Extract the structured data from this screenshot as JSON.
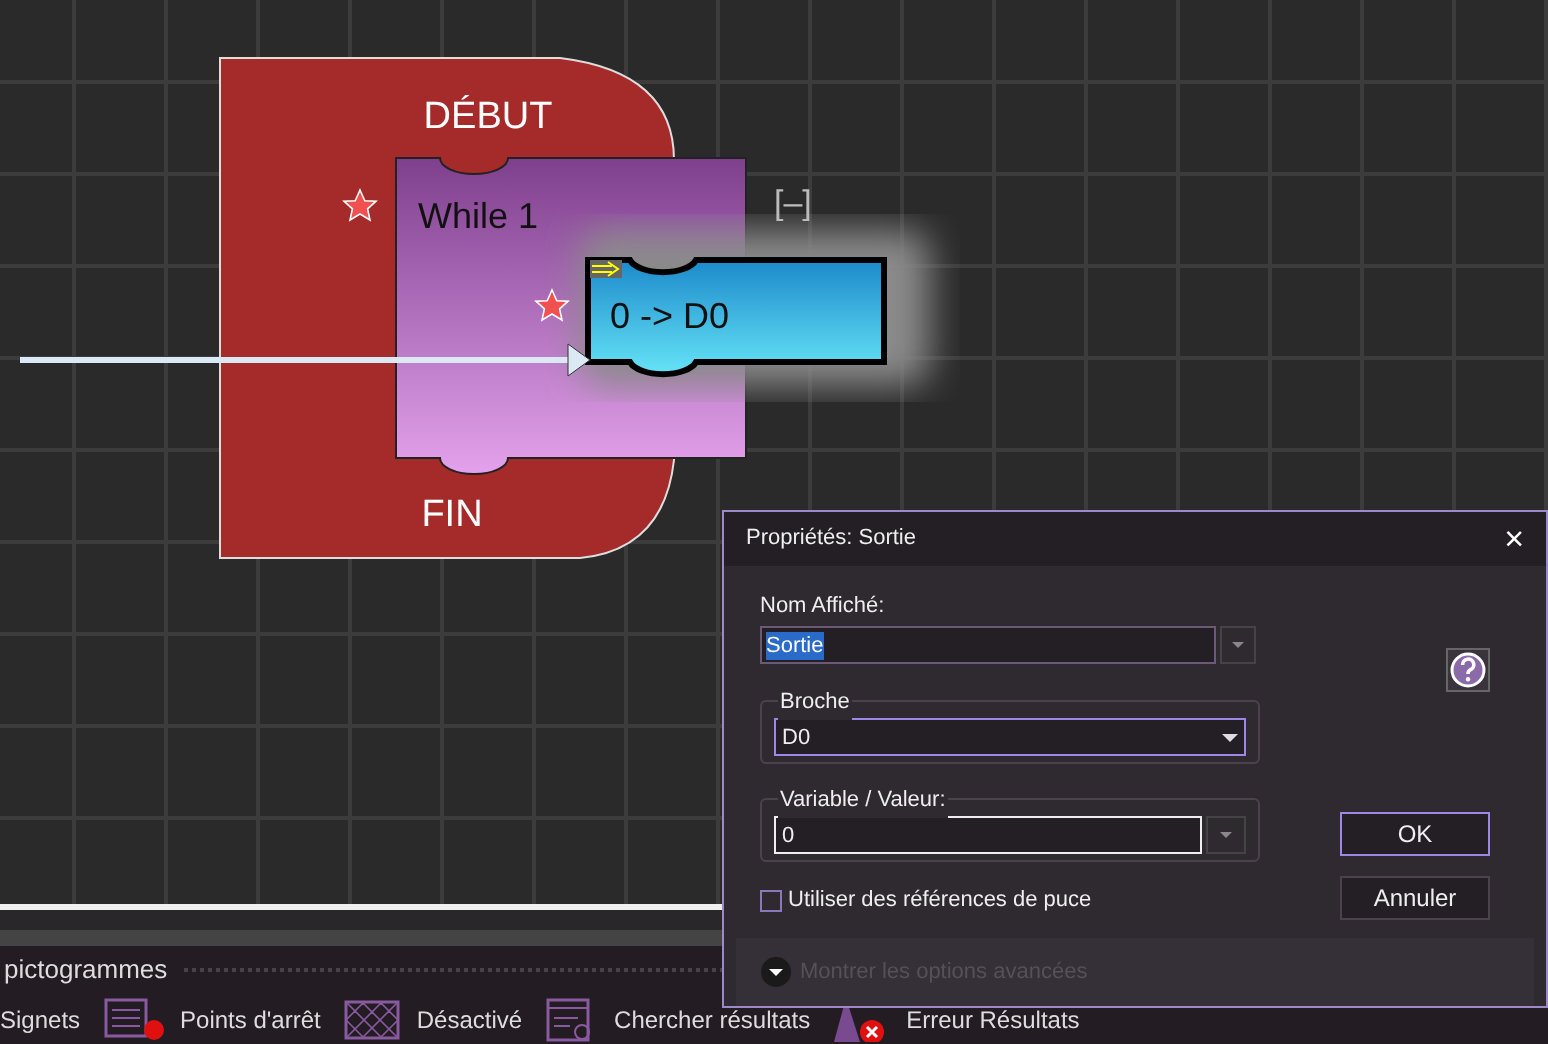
{
  "diagram": {
    "start_label": "DÉBUT",
    "end_label": "FIN",
    "loop_label": "While 1",
    "block_label": "0 -> D0",
    "collapse_toggle": "[–]"
  },
  "panel": {
    "title": "pictogrammes",
    "legend": [
      {
        "label": "Signets",
        "kind": "plain"
      },
      {
        "label": "Points d'arrêt",
        "kind": "breakpoint"
      },
      {
        "label": "Désactivé",
        "kind": "disabled"
      },
      {
        "label": "Chercher résultats",
        "kind": "search"
      },
      {
        "label": "Erreur Résultats",
        "kind": "error"
      }
    ]
  },
  "dialog": {
    "title": "Propriétés: Sortie",
    "close": "×",
    "name_label": "Nom Affiché:",
    "name_value": "Sortie",
    "pin_label": "Broche",
    "pin_value": "D0",
    "value_label": "Variable / Valeur:",
    "value_value": "0",
    "chip_refs": {
      "label": "Utiliser des références de puce",
      "checked": false
    },
    "advanced": {
      "label": "Montrer les options avancées",
      "disabled": true
    },
    "buttons": [
      {
        "label": "OK",
        "default": true
      },
      {
        "label": "Annuler",
        "default": false
      }
    ]
  }
}
